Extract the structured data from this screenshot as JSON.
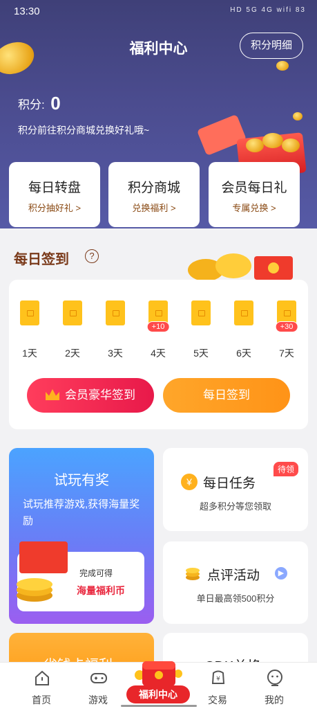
{
  "status_bar": {
    "time": "13:30",
    "icons": "HD 5G 4G wifi 83"
  },
  "header": {
    "title": "福利中心",
    "detail_button": "积分明细"
  },
  "points": {
    "label": "积分:",
    "value": "0",
    "tip": "积分前往积分商城兑换好礼哦~"
  },
  "quick_entries": [
    {
      "title": "每日转盘",
      "sub": "积分抽好礼 >"
    },
    {
      "title": "积分商城",
      "sub": "兑换福利 >"
    },
    {
      "title": "会员每日礼",
      "sub": "专属兑换 >"
    }
  ],
  "signin": {
    "title": "每日签到",
    "help": "?",
    "days": [
      {
        "label": "1天",
        "bonus": ""
      },
      {
        "label": "2天",
        "bonus": ""
      },
      {
        "label": "3天",
        "bonus": ""
      },
      {
        "label": "4天",
        "bonus": "+10"
      },
      {
        "label": "5天",
        "bonus": ""
      },
      {
        "label": "6天",
        "bonus": ""
      },
      {
        "label": "7天",
        "bonus": "+30"
      }
    ],
    "vip_button": "会员豪华签到",
    "daily_button": "每日签到"
  },
  "trial": {
    "title": "试玩有奖",
    "desc": "试玩推荐游戏,获得海量奖励",
    "inner_label": "完成可得",
    "inner_value": "海量福利币"
  },
  "daily_task": {
    "title": "每日任务",
    "badge": "待领",
    "sub": "超多积分等您领取",
    "icon_glyph": "¥"
  },
  "review": {
    "title": "点评活动",
    "sub": "单日最高领500积分"
  },
  "save_card": {
    "title": "省钱卡福利"
  },
  "cdk_card": {
    "title": "CDK兑换"
  },
  "tabbar": {
    "items": [
      {
        "label": "首页",
        "icon": "home-icon"
      },
      {
        "label": "游戏",
        "icon": "gamepad-icon"
      },
      {
        "label": "福利中心",
        "icon": "gift-icon"
      },
      {
        "label": "交易",
        "icon": "trade-icon"
      },
      {
        "label": "我的",
        "icon": "profile-icon"
      }
    ]
  },
  "colors": {
    "hero": "#4b4c8f",
    "accent_orange": "#ff9a1f",
    "accent_red": "#e8194a",
    "brown": "#7a3a1a"
  }
}
